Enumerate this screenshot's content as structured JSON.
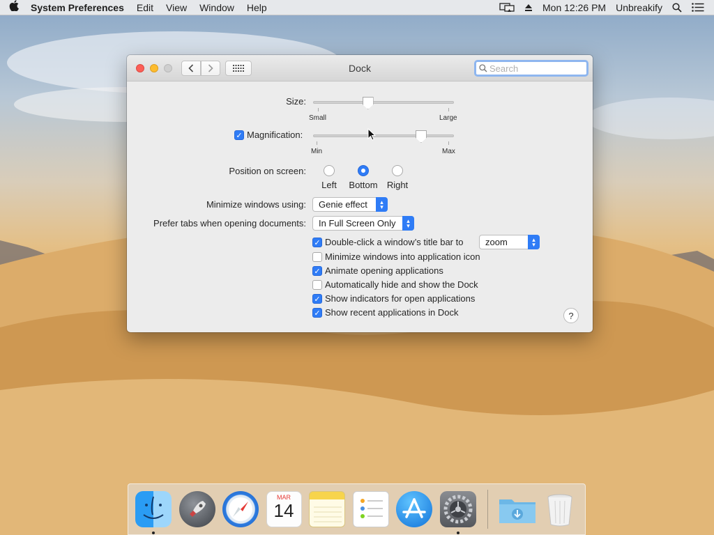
{
  "menubar": {
    "app_name": "System Preferences",
    "menus": [
      "Edit",
      "View",
      "Window",
      "Help"
    ],
    "clock": "Mon 12:26 PM",
    "user": "Unbreakify"
  },
  "window": {
    "title": "Dock",
    "search_placeholder": "Search"
  },
  "size": {
    "label": "Size:",
    "min_label": "Small",
    "max_label": "Large",
    "value": 0.38
  },
  "magnification": {
    "label": "Magnification:",
    "checked": true,
    "min_label": "Min",
    "max_label": "Max",
    "value": 0.79
  },
  "position": {
    "label": "Position on screen:",
    "options": [
      "Left",
      "Bottom",
      "Right"
    ],
    "selected": "Bottom"
  },
  "minimize": {
    "label": "Minimize windows using:",
    "value": "Genie effect"
  },
  "prefer_tabs": {
    "label": "Prefer tabs when opening documents:",
    "value": "In Full Screen Only"
  },
  "double_click": {
    "label": "Double-click a window’s title bar to",
    "checked": true,
    "value": "zoom"
  },
  "options": [
    {
      "label": "Minimize windows into application icon",
      "checked": false
    },
    {
      "label": "Animate opening applications",
      "checked": true
    },
    {
      "label": "Automatically hide and show the Dock",
      "checked": false
    },
    {
      "label": "Show indicators for open applications",
      "checked": true
    },
    {
      "label": "Show recent applications in Dock",
      "checked": true
    }
  ],
  "help_label": "?",
  "dock": {
    "calendar_month": "MAR",
    "calendar_day": "14",
    "items": [
      "finder-icon",
      "launchpad-icon",
      "safari-icon",
      "calendar-icon",
      "notes-icon",
      "reminders-icon",
      "app-store-icon",
      "system-preferences-icon",
      "downloads-folder-icon",
      "trash-icon"
    ]
  },
  "colors": {
    "accent": "#2f7cf6"
  }
}
